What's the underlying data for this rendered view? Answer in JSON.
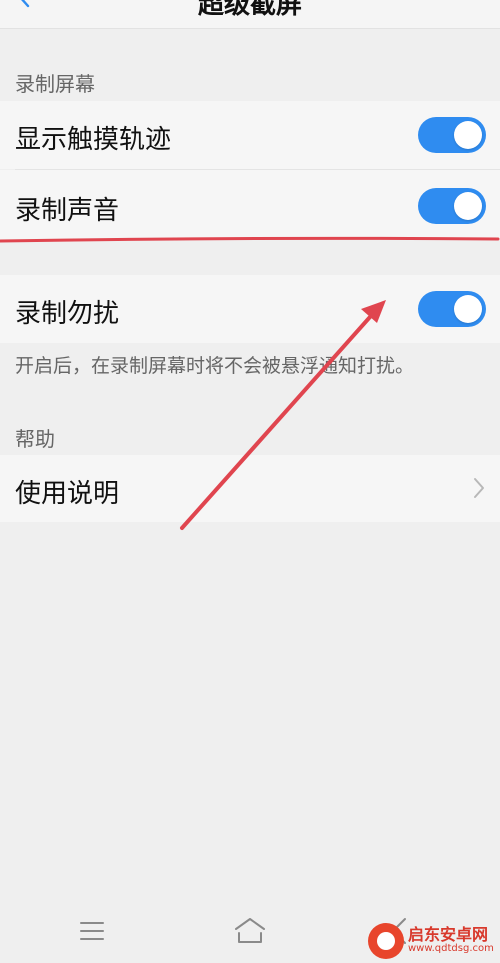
{
  "header": {
    "title": "超级截屏"
  },
  "sections": {
    "record_screen": {
      "title": "录制屏幕",
      "show_touch_label": "显示触摸轨迹",
      "show_touch_on": true,
      "record_sound_label": "录制声音",
      "record_sound_on": true
    },
    "dnd": {
      "label": "录制勿扰",
      "on": true,
      "description": "开启后，在录制屏幕时将不会被悬浮通知打扰。"
    },
    "help": {
      "title": "帮助",
      "instructions_label": "使用说明"
    }
  },
  "colors": {
    "toggle_on": "#2f8cf0",
    "annotation": "#e0454f",
    "background": "#efefef",
    "row": "#f6f6f6"
  },
  "icons": {
    "back": "back-icon",
    "chevron": "chevron-right-icon",
    "menu": "menu-icon",
    "home": "home-icon",
    "back_nav": "back-nav-icon"
  },
  "watermark": {
    "title": "启东安卓网",
    "url": "www.qdtdsg.com"
  }
}
